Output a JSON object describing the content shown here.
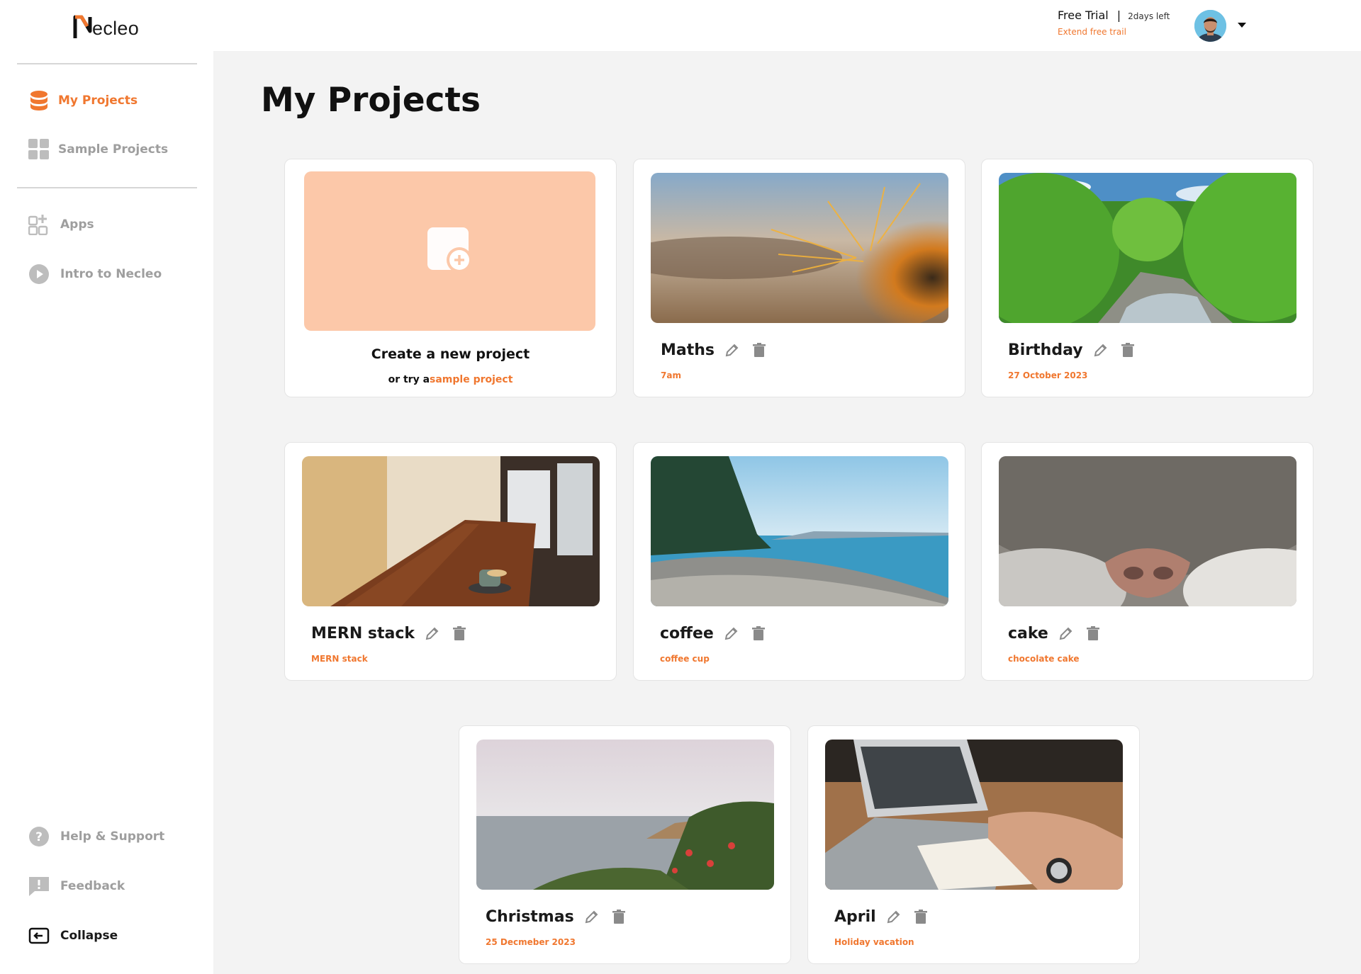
{
  "brand": {
    "logo_text": "ecleo",
    "logo_letter": "N"
  },
  "header": {
    "trial_label": "Free Trial",
    "separator": "|",
    "days_left": "2days left",
    "extend_link": "Extend free trail"
  },
  "sidebar": {
    "items": [
      {
        "label": "My Projects",
        "icon": "database-stack-icon",
        "active": true
      },
      {
        "label": "Sample Projects",
        "icon": "grid-squares-icon"
      },
      {
        "label": "Apps",
        "icon": "apps-grid-plus-icon"
      },
      {
        "label": "Intro to Necleo",
        "icon": "play-circle-icon"
      }
    ],
    "bottom_items": [
      {
        "label": "Help & Support",
        "icon": "question-circle-icon"
      },
      {
        "label": "Feedback",
        "icon": "feedback-bubble-icon"
      },
      {
        "label": "Collapse",
        "icon": "collapse-arrow-icon"
      }
    ]
  },
  "main": {
    "page_title": "My Projects",
    "new_project": {
      "title": "Create a new project",
      "sub_prefix": "or try a",
      "sub_link": "sample project"
    },
    "projects": [
      {
        "title": "Maths",
        "subtitle": "7am",
        "image": "cactus-spines-closeup"
      },
      {
        "title": "Birthday",
        "subtitle": "27 October 2023",
        "image": "green-forest-river"
      },
      {
        "title": "MERN stack",
        "subtitle": "MERN stack",
        "image": "cafe-table-coffee"
      },
      {
        "title": "coffee",
        "subtitle": "coffee cup",
        "image": "pebble-beach-sea"
      },
      {
        "title": "cake",
        "subtitle": "chocolate cake",
        "image": "cat-nose-closeup"
      },
      {
        "title": "Christmas",
        "subtitle": "25 Decmeber 2023",
        "image": "coastal-flowers-sea"
      },
      {
        "title": "April",
        "subtitle": "Holiday vacation",
        "image": "laptop-notebook-writing"
      }
    ]
  },
  "colors": {
    "accent": "#f0772f",
    "tile_peach": "#fcc8a9",
    "main_bg": "#f3f3f3",
    "muted": "#9e9e9e"
  }
}
